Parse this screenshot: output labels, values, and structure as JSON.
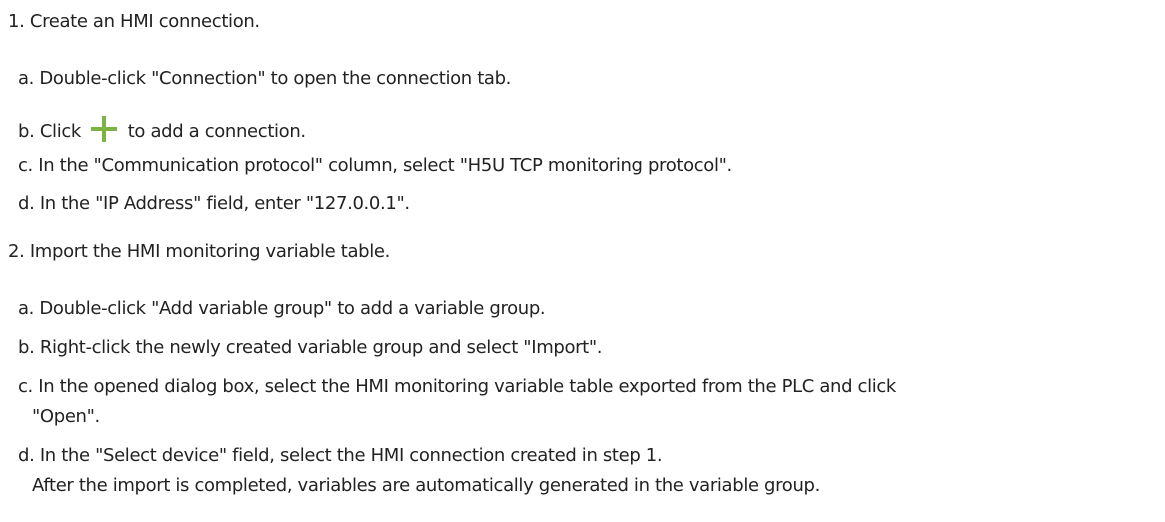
{
  "step1": {
    "title": "1. Create an HMI connection.",
    "a": "a. Double-click \"Connection\" to open the connection tab.",
    "b_prefix": "b. Click",
    "b_suffix": "to add a connection.",
    "c": "c. In the \"Communication protocol\" column, select \"H5U TCP monitoring protocol\".",
    "d": "d. In the \"IP Address\" field, enter \"127.0.0.1\"."
  },
  "step2": {
    "title": "2. Import the HMI monitoring variable table.",
    "a": "a. Double-click \"Add variable group\" to add a variable group.",
    "b": "b. Right-click the newly created variable group and select \"Import\".",
    "c_line1": "c. In the opened dialog box, select the HMI monitoring variable table exported from the PLC and click",
    "c_line2": "\"Open\".",
    "d": "d. In the \"Select device\" field, select the HMI connection created in step 1.",
    "note": "After the import is completed, variables are automatically generated in the variable group."
  },
  "icons": {
    "add": "plus-icon",
    "add_color": "#7cb342"
  }
}
